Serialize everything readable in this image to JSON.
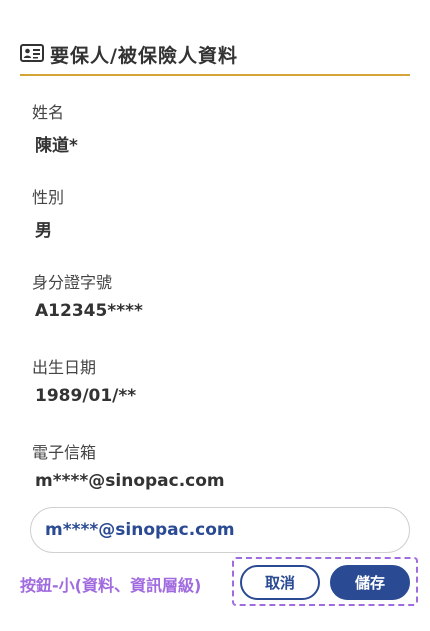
{
  "header": {
    "title": "要保人/被保險人資料",
    "icon": "id-card-icon",
    "accent_color": "#d4a437"
  },
  "fields": [
    {
      "label": "姓名",
      "value": "陳道*"
    },
    {
      "label": "性別",
      "value": "男"
    },
    {
      "label": "身分證字號",
      "value": "A12345****"
    },
    {
      "label": "出生日期",
      "value": "1989/01/**"
    },
    {
      "label": "電子信箱",
      "value": "m****@sinopac.com"
    }
  ],
  "email_input": {
    "value": "m****@sinopac.com"
  },
  "annotation": {
    "text": "按鈕-小(資料、資訊層級)",
    "color": "#a16be0"
  },
  "buttons": {
    "cancel_label": "取消",
    "save_label": "儲存",
    "primary_color": "#2a4a93"
  }
}
